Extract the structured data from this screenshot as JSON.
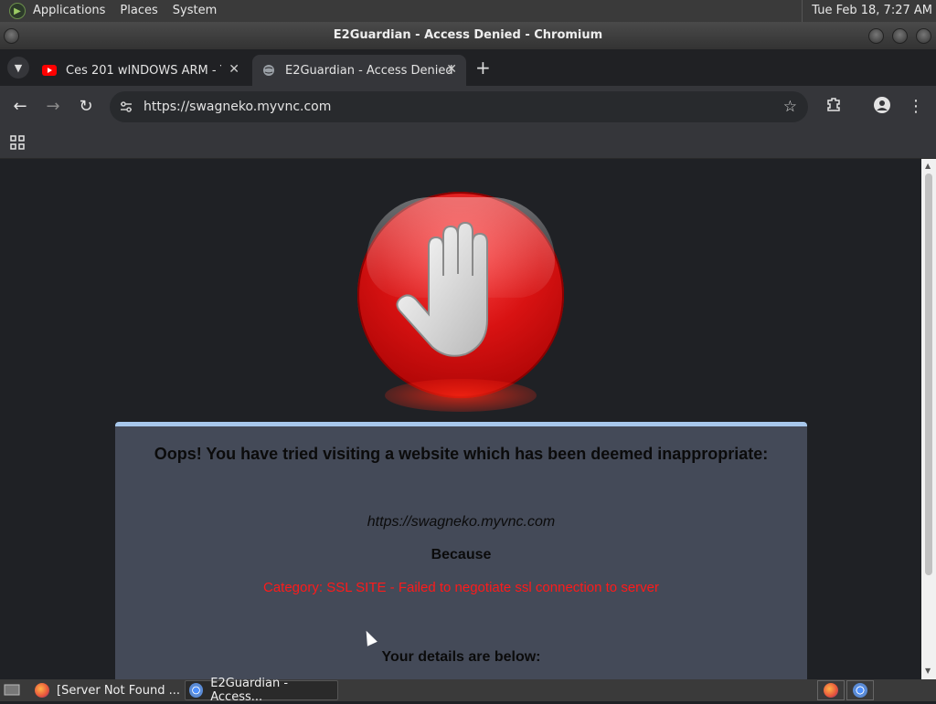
{
  "desktop": {
    "menu": [
      "Applications",
      "Places",
      "System"
    ],
    "clock": "Tue Feb 18,  7:27 AM"
  },
  "window": {
    "title": "E2Guardian - Access Denied - Chromium"
  },
  "tabs": [
    {
      "label": "Ces 201 wINDOWS ARM - Yo",
      "favicon": "youtube-icon",
      "active": false
    },
    {
      "label": "E2Guardian - Access Denied",
      "favicon": "globe-icon",
      "active": true
    }
  ],
  "toolbar": {
    "url": "https://swagneko.myvnc.com"
  },
  "page": {
    "heading": "Oops! You have tried visiting a website which has been deemed inappropriate:",
    "blocked_url": "https://swagneko.myvnc.com",
    "because": "Because",
    "reason": "Category: SSL SITE - Failed to negotiate ssl connection to server",
    "details_heading": "Your details are below:",
    "accent_color": "#a8c8ec",
    "reason_color": "#ff1a1a"
  },
  "taskbar": {
    "tasks": [
      {
        "label": "[Server Not Found ...",
        "icon": "firefox-icon",
        "active": false
      },
      {
        "label": "E2Guardian - Access...",
        "icon": "chromium-icon",
        "active": true
      }
    ],
    "tray": [
      "firefox-icon",
      "chromium-icon"
    ]
  }
}
